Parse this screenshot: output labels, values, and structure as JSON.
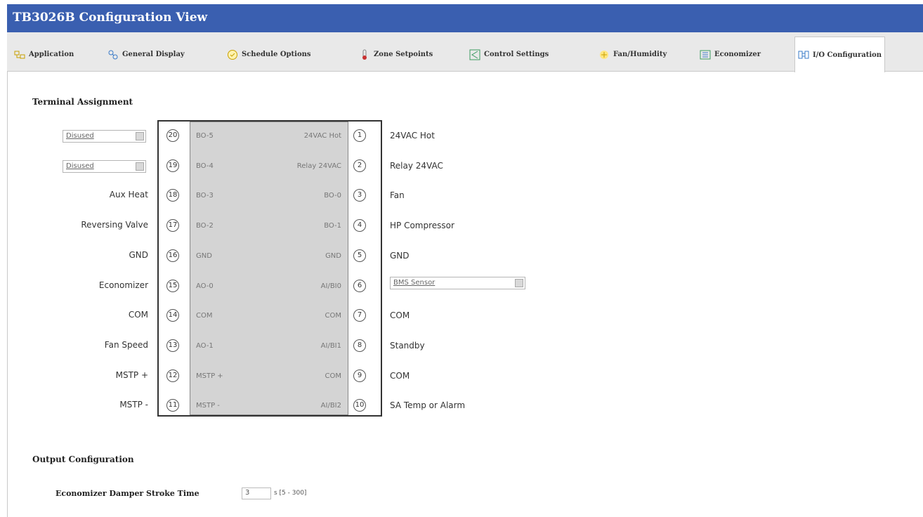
{
  "window": {
    "title": "TB3026B Configuration View"
  },
  "tabs": [
    {
      "label": "Application",
      "icon": "application-icon"
    },
    {
      "label": "General Display",
      "icon": "general-display-icon"
    },
    {
      "label": "Schedule Options",
      "icon": "schedule-options-icon"
    },
    {
      "label": "Zone Setpoints",
      "icon": "zone-setpoints-icon"
    },
    {
      "label": "Control Settings",
      "icon": "control-settings-icon"
    },
    {
      "label": "Fan/Humidity",
      "icon": "fan-humidity-icon"
    },
    {
      "label": "Economizer",
      "icon": "economizer-icon"
    },
    {
      "label": "I/O Configuration",
      "icon": "io-configuration-icon",
      "active": true
    }
  ],
  "terminal": {
    "section_title": "Terminal Assignment",
    "left_rows": [
      {
        "num": "20",
        "code": "BO-5",
        "label": "Disused",
        "select": true
      },
      {
        "num": "19",
        "code": "BO-4",
        "label": "Disused",
        "select": true
      },
      {
        "num": "18",
        "code": "BO-3",
        "label": "Aux Heat"
      },
      {
        "num": "17",
        "code": "BO-2",
        "label": "Reversing Valve"
      },
      {
        "num": "16",
        "code": "GND",
        "label": "GND"
      },
      {
        "num": "15",
        "code": "AO-0",
        "label": "Economizer"
      },
      {
        "num": "14",
        "code": "COM",
        "label": "COM"
      },
      {
        "num": "13",
        "code": "AO-1",
        "label": "Fan Speed"
      },
      {
        "num": "12",
        "code": "MSTP +",
        "label": "MSTP +"
      },
      {
        "num": "11",
        "code": "MSTP -",
        "label": "MSTP -"
      }
    ],
    "right_rows": [
      {
        "num": "1",
        "code": "24VAC Hot",
        "label": "24VAC Hot"
      },
      {
        "num": "2",
        "code": "Relay 24VAC",
        "label": "Relay 24VAC"
      },
      {
        "num": "3",
        "code": "BO-0",
        "label": "Fan"
      },
      {
        "num": "4",
        "code": "BO-1",
        "label": "HP Compressor"
      },
      {
        "num": "5",
        "code": "GND",
        "label": "GND"
      },
      {
        "num": "6",
        "code": "AI/BI0",
        "label": "BMS Sensor",
        "select": true
      },
      {
        "num": "7",
        "code": "COM",
        "label": "COM"
      },
      {
        "num": "8",
        "code": "AI/BI1",
        "label": "Standby"
      },
      {
        "num": "9",
        "code": "COM",
        "label": "COM"
      },
      {
        "num": "10",
        "code": "AI/BI2",
        "label": "SA Temp or Alarm"
      }
    ]
  },
  "output": {
    "section_title": "Output Configuration",
    "damper_label": "Economizer Damper Stroke Time",
    "damper_value": "3",
    "damper_unit": "s [5 - 300]"
  },
  "colors": {
    "title_bar": "#3a5fb0",
    "tab_bar": "#e9e9e9",
    "terminal_fill": "#d4d4d4"
  }
}
